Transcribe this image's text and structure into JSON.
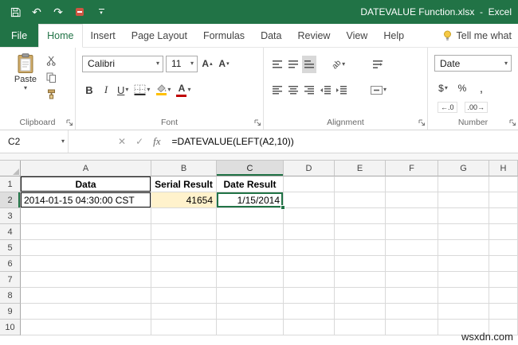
{
  "titlebar": {
    "title": "DATEVALUE Function.xlsx  -  Excel"
  },
  "icons": {
    "qat": [
      "save",
      "undo",
      "redo",
      "qat-custom",
      "customize-quick-access"
    ],
    "tellme": "lightbulb"
  },
  "tabs": {
    "file": "File",
    "home": "Home",
    "insert": "Insert",
    "page_layout": "Page Layout",
    "formulas": "Formulas",
    "data": "Data",
    "review": "Review",
    "view": "View",
    "help": "Help",
    "tell_me": "Tell me what"
  },
  "ribbon": {
    "clipboard": {
      "label": "Clipboard",
      "paste_label": "Paste"
    },
    "font": {
      "label": "Font",
      "font_name": "Calibri",
      "font_size": "11",
      "bold": "B",
      "italic": "I",
      "underline": "U",
      "grow_font": "A",
      "shrink_font": "A",
      "font_color_letter": "A",
      "fill_accent": "#FFC000",
      "font_color_accent": "#C00000"
    },
    "alignment": {
      "label": "Alignment",
      "orientation_text": "ab"
    },
    "number": {
      "label": "Number",
      "format": "Date",
      "currency": "$",
      "percent": "%",
      "comma": ",",
      "increase_decimal": "←.0",
      "decrease_decimal": ".00→"
    }
  },
  "formula_bar": {
    "name_box": "C2",
    "cancel": "✕",
    "enter": "✓",
    "fx": "fx",
    "formula": "=DATEVALUE(LEFT(A2,10))"
  },
  "grid": {
    "columns": [
      "A",
      "B",
      "C",
      "D",
      "E",
      "F",
      "G",
      "H"
    ],
    "selected_column": "C",
    "selected_row": 2,
    "row_count": 10,
    "cells": [
      {
        "col": "A",
        "row": 1,
        "text": "Data",
        "bold": true,
        "align": "center",
        "border": "black"
      },
      {
        "col": "B",
        "row": 1,
        "text": "Serial Result",
        "bold": true,
        "align": "center"
      },
      {
        "col": "C",
        "row": 1,
        "text": "Date Result",
        "bold": true,
        "align": "center"
      },
      {
        "col": "A",
        "row": 2,
        "text": "2014-01-15 04:30:00 CST",
        "align": "left",
        "border": "black"
      },
      {
        "col": "B",
        "row": 2,
        "text": "41654",
        "align": "right",
        "fill": "#FFF2CC"
      },
      {
        "col": "C",
        "row": 2,
        "text": "1/15/2014",
        "align": "right",
        "selected": true
      }
    ]
  },
  "colors": {
    "excel_green": "#217346",
    "selection_green": "#217346",
    "result_fill": "#FFF2CC",
    "font_color_bar": "#C00000",
    "fill_color_bar": "#FFC000"
  },
  "watermark": "wsxdn.com"
}
